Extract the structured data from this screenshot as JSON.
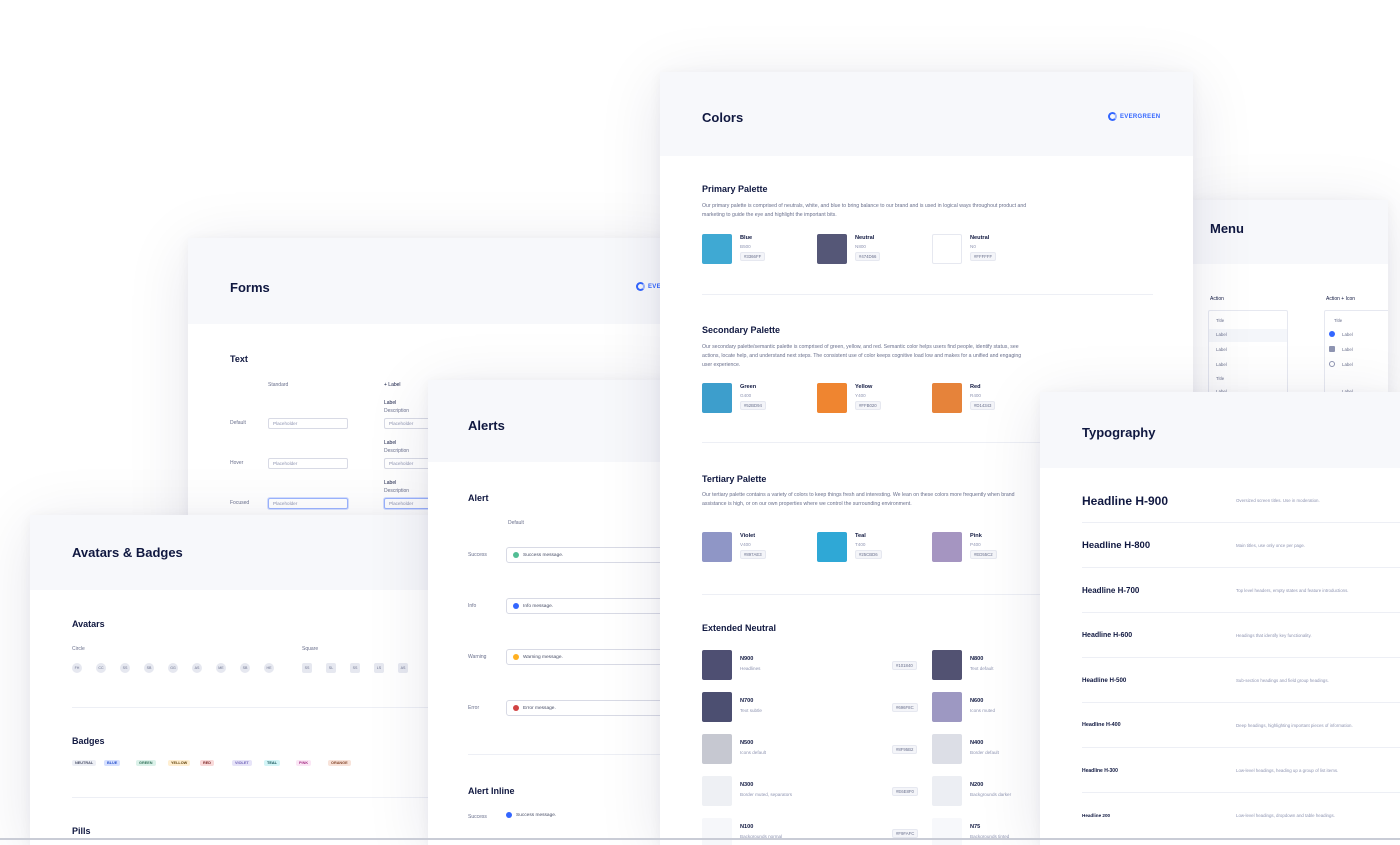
{
  "brand": "EVERGREEN",
  "colors": {
    "title": "Colors",
    "primary": {
      "heading": "Primary Palette",
      "description": "Our primary palette is comprised of neutrals, white, and blue to bring balance to our brand and is used in logical ways throughout product and marketing to guide the eye and highlight the important bits.",
      "swatches": [
        {
          "name": "Blue",
          "sub": "B500",
          "hex": "#3366FF",
          "color": "#3fa9d3"
        },
        {
          "name": "Neutral",
          "sub": "N800",
          "hex": "#474D66",
          "color": "#555777"
        },
        {
          "name": "Neutral",
          "sub": "N0",
          "hex": "#FFFFFF",
          "color": "#ffffff"
        }
      ]
    },
    "secondary": {
      "heading": "Secondary Palette",
      "description": "Our secondary palette/semantic palette is comprised of green, yellow, and red. Semantic color helps users find people, identify status, see actions, locate help, and understand next steps. The consistent use of color keeps cognitive load low and makes for a unified and engaging user experience.",
      "swatches": [
        {
          "name": "Green",
          "sub": "G400",
          "hex": "#52BD94",
          "color": "#3d9ecc"
        },
        {
          "name": "Yellow",
          "sub": "Y400",
          "hex": "#FFB020",
          "color": "#ef8530"
        },
        {
          "name": "Red",
          "sub": "R400",
          "hex": "#D14343",
          "color": "#e6833a"
        }
      ]
    },
    "tertiary": {
      "heading": "Tertiary Palette",
      "description": "Our tertiary palette contains a variety of colors to keep things fresh and interesting. We lean on these colors more frequently when brand assistance is high, or on our own properties where we control the surrounding environment.",
      "swatches": [
        {
          "name": "Violet",
          "sub": "V400",
          "hex": "#897AE3",
          "color": "#8f96c6"
        },
        {
          "name": "Teal",
          "sub": "T400",
          "hex": "#25CBD6",
          "color": "#2fa8d6"
        },
        {
          "name": "Pink",
          "sub": "P400",
          "hex": "#ED55C2",
          "color": "#a595c1"
        }
      ]
    },
    "extended": {
      "heading": "Extended Neutral",
      "left": [
        {
          "name": "N900",
          "sub": "Headlines",
          "hex": "#101840",
          "color": "#4e4f72"
        },
        {
          "name": "N700",
          "sub": "Text subtle",
          "hex": "#696F8C",
          "color": "#4c4f71"
        },
        {
          "name": "N500",
          "sub": "Icons default",
          "hex": "#8F95B2",
          "color": "#c6c8d1"
        },
        {
          "name": "N300",
          "sub": "Border muted, separators",
          "hex": "#E6E8F0",
          "color": "#eef0f4"
        },
        {
          "name": "N100",
          "sub": "Backgrounds normal",
          "hex": "#F9FAFC",
          "color": "#f6f7fa"
        }
      ],
      "right": [
        {
          "name": "N800",
          "sub": "Text default",
          "color": "#525272"
        },
        {
          "name": "N600",
          "sub": "Icons muted",
          "color": "#9d98c2"
        },
        {
          "name": "N400",
          "sub": "Border default",
          "color": "#dcdee6"
        },
        {
          "name": "N200",
          "sub": "Backgrounds darker",
          "color": "#eceef3"
        },
        {
          "name": "N75",
          "sub": "Backgrounds tinted",
          "color": "#f7f8fb"
        }
      ]
    }
  },
  "forms": {
    "title": "Forms",
    "section": "Text",
    "col_standard": "Standard",
    "col_label": "+ Label",
    "rows": [
      {
        "label": "Default",
        "placeholder": "Placeholder",
        "field_label": "Label",
        "field_desc": "Description",
        "field_placeholder": "Placeholder"
      },
      {
        "label": "Hover",
        "placeholder": "Placeholder",
        "field_label": "Label",
        "field_desc": "Description",
        "field_placeholder": "Placeholder"
      },
      {
        "label": "Focused",
        "placeholder": "Placeholder",
        "field_label": "Label",
        "field_desc": "Description",
        "field_placeholder": "Placeholder"
      }
    ]
  },
  "alerts": {
    "title": "Alerts",
    "section": "Alert",
    "col_default": "Default",
    "rows": [
      {
        "label": "Success",
        "message": "Success message.",
        "color": "#52bd94"
      },
      {
        "label": "Info",
        "message": "Info message.",
        "color": "#3366ff"
      },
      {
        "label": "Warning",
        "message": "Warning message.",
        "color": "#ffb020"
      },
      {
        "label": "Error",
        "message": "Error message.",
        "color": "#d14343"
      }
    ],
    "inline_section": "Alert Inline",
    "inline_row": {
      "label": "Success",
      "message": "Success message.",
      "color": "#3366ff"
    }
  },
  "avatars": {
    "title": "Avatars & Badges",
    "section_avatars": "Avatars",
    "circle_label": "Circle",
    "square_label": "Square",
    "circle_initials": [
      "FH",
      "CC",
      "SS",
      "SB",
      "GG",
      "AS",
      "ME",
      "SB",
      "HE"
    ],
    "square_initials": [
      "SS",
      "SL",
      "SS",
      "LS",
      "AS"
    ],
    "section_badges": "Badges",
    "badges": [
      {
        "label": "NEUTRAL",
        "bg": "#edeff5",
        "fg": "#474d66"
      },
      {
        "label": "BLUE",
        "bg": "#d6e0ff",
        "fg": "#2952cc"
      },
      {
        "label": "GREEN",
        "bg": "#dcf2ea",
        "fg": "#317159"
      },
      {
        "label": "YELLOW",
        "bg": "#ffefd2",
        "fg": "#66460d"
      },
      {
        "label": "RED",
        "bg": "#f9dada",
        "fg": "#7d2828"
      },
      {
        "label": "VIOLET",
        "bg": "#e7e4f9",
        "fg": "#6e62b6"
      },
      {
        "label": "TEAL",
        "bg": "#d3f5f7",
        "fg": "#0f5156"
      },
      {
        "label": "PINK",
        "bg": "#fbe6f5",
        "fg": "#a73388"
      },
      {
        "label": "ORANGE",
        "bg": "#f8e3da",
        "fg": "#85462b"
      }
    ],
    "section_pills": "Pills"
  },
  "menu": {
    "title": "Menu",
    "col_action": "Action",
    "col_action_icon": "Action + Icon",
    "action_items": [
      "Title",
      "Label",
      "Label",
      "Label",
      "Title",
      "Label"
    ],
    "icon_items": [
      "Title",
      "Label",
      "Label",
      "Label",
      "Label"
    ]
  },
  "typography": {
    "title": "Typography",
    "rows": [
      {
        "name": "Headline H-900",
        "desc": "Oversized screen titles. Use in moderation."
      },
      {
        "name": "Headline H-800",
        "desc": "Main titles, use only once per page."
      },
      {
        "name": "Headline H-700",
        "desc": "Top level headers, empty states and feature introductions."
      },
      {
        "name": "Headline H-600",
        "desc": "Headings that identify key functionality."
      },
      {
        "name": "Headline H-500",
        "desc": "Sub-section headings and field group headings."
      },
      {
        "name": "Headline H-400",
        "desc": "Deep headings, highlighting important pieces of information."
      },
      {
        "name": "Headline H-300",
        "desc": "Low-level headings, heading up a group of list items."
      },
      {
        "name": "Headline 200",
        "desc": "Low-level headings, dropdown and table headings."
      }
    ]
  }
}
